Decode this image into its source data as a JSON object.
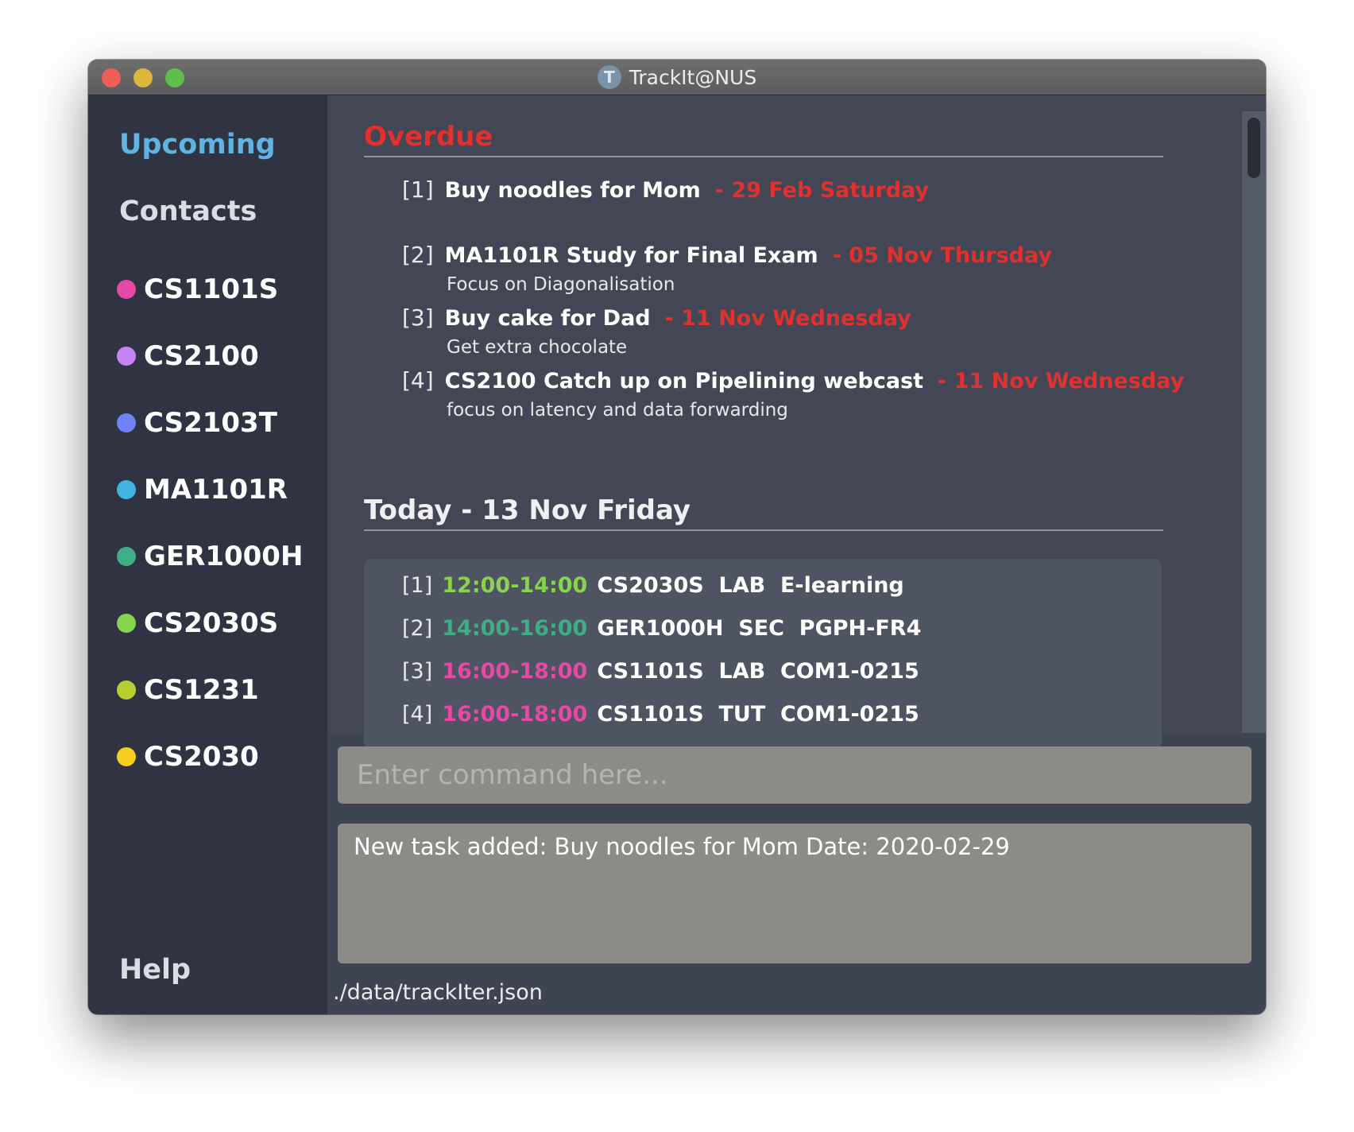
{
  "window": {
    "title": "TrackIt@NUS",
    "app_icon_letter": "T"
  },
  "sidebar": {
    "upcoming": "Upcoming",
    "contacts": "Contacts",
    "help": "Help",
    "modules": [
      {
        "label": "CS1101S",
        "color": "#e64aa6"
      },
      {
        "label": "CS2100",
        "color": "#c483f4"
      },
      {
        "label": "CS2103T",
        "color": "#6f82f7"
      },
      {
        "label": "MA1101R",
        "color": "#41b4e4"
      },
      {
        "label": "GER1000H",
        "color": "#3fae84"
      },
      {
        "label": "CS2030S",
        "color": "#85d44c"
      },
      {
        "label": "CS1231",
        "color": "#b6cf2f"
      },
      {
        "label": "CS2030",
        "color": "#f6ce1d"
      }
    ]
  },
  "overdue": {
    "title": "Overdue",
    "tasks": [
      {
        "index": "[1]",
        "name": "Buy noodles for Mom",
        "date": "- 29 Feb Saturday",
        "desc": ""
      },
      {
        "index": "[2]",
        "name": "MA1101R Study for Final Exam",
        "date": "- 05 Nov Thursday",
        "desc": "Focus on Diagonalisation"
      },
      {
        "index": "[3]",
        "name": "Buy cake for Dad",
        "date": "- 11 Nov Wednesday",
        "desc": "Get extra chocolate"
      },
      {
        "index": "[4]",
        "name": "CS2100 Catch up on Pipelining webcast",
        "date": "- 11 Nov Wednesday",
        "desc": "focus on latency and data forwarding"
      }
    ]
  },
  "today": {
    "title": "Today - 13 Nov Friday",
    "lessons": [
      {
        "index": "[1]",
        "time": "12:00-14:00",
        "color": "#85d44c",
        "info": "CS2030S  LAB  E-learning"
      },
      {
        "index": "[2]",
        "time": "14:00-16:00",
        "color": "#3fae84",
        "info": "GER1000H  SEC  PGPH-FR4"
      },
      {
        "index": "[3]",
        "time": "16:00-18:00",
        "color": "#e64aa6",
        "info": "CS1101S  LAB  COM1-0215"
      },
      {
        "index": "[4]",
        "time": "16:00-18:00",
        "color": "#e64aa6",
        "info": "CS1101S  TUT  COM1-0215"
      }
    ]
  },
  "command": {
    "placeholder": "Enter command here...",
    "value": ""
  },
  "result": {
    "text": "New task added: Buy noodles for Mom Date: 2020-02-29"
  },
  "status": {
    "path": "./data/trackIter.json"
  }
}
